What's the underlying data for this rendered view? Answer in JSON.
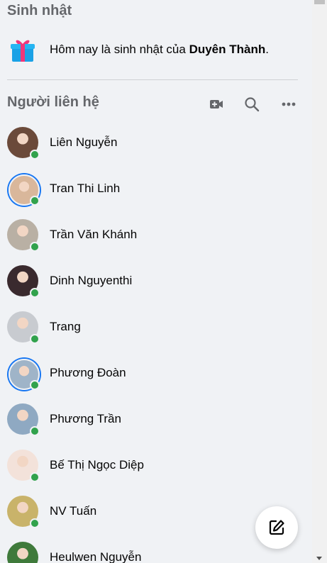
{
  "birthdays": {
    "title": "Sinh nhật",
    "text_prefix": "Hôm nay là sinh nhật của ",
    "name": "Duyên Thành",
    "text_suffix": "."
  },
  "contacts": {
    "title": "Người liên hệ",
    "actions": [
      {
        "icon": "video-plus-icon"
      },
      {
        "icon": "search-icon"
      },
      {
        "icon": "more-icon"
      }
    ],
    "items": [
      {
        "name": "Liên Nguyễn",
        "online": true,
        "story": false,
        "color": "#6b4a3a"
      },
      {
        "name": "Tran Thi Linh",
        "online": true,
        "story": true,
        "color": "#d9b79b"
      },
      {
        "name": "Trần Văn Khánh",
        "online": true,
        "story": false,
        "color": "#b9b0a4"
      },
      {
        "name": "Dinh Nguyenthi",
        "online": true,
        "story": false,
        "color": "#3a2a2e"
      },
      {
        "name": "Trang",
        "online": true,
        "story": false,
        "color": "#c8cbd0"
      },
      {
        "name": "Phương Đoàn",
        "online": true,
        "story": true,
        "color": "#9fb4c8"
      },
      {
        "name": "Phương Trần",
        "online": true,
        "story": false,
        "color": "#8fa9c2"
      },
      {
        "name": "Bế Thị Ngọc Diệp",
        "online": true,
        "story": false,
        "color": "#f3e2da"
      },
      {
        "name": "NV Tuấn",
        "online": true,
        "story": false,
        "color": "#c9b36a"
      },
      {
        "name": "Heulwen Nguyễn",
        "online": false,
        "story": false,
        "color": "#3f7a3b"
      }
    ]
  },
  "compose_button": {
    "icon": "compose-icon"
  },
  "colors": {
    "accent": "#1877f2",
    "online": "#31a24c",
    "muted": "#65676b"
  }
}
